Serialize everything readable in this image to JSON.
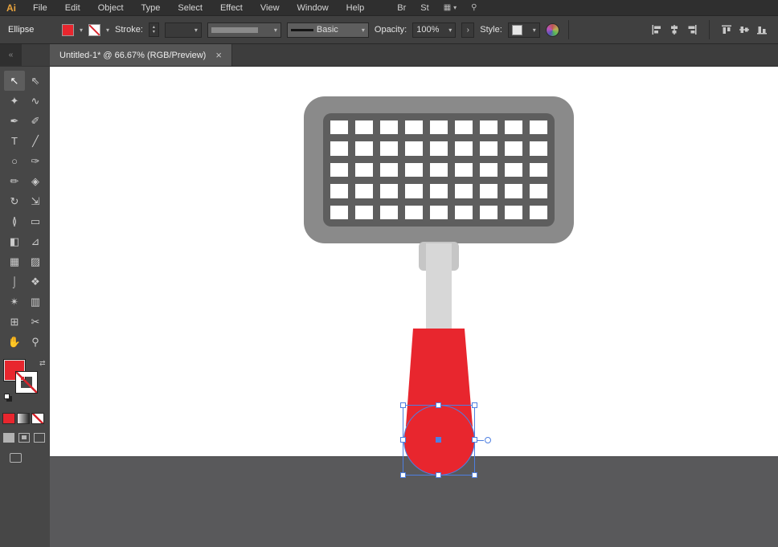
{
  "app": {
    "logo_text": "Ai"
  },
  "menubar": {
    "items": [
      "File",
      "Edit",
      "Object",
      "Type",
      "Select",
      "Effect",
      "View",
      "Window",
      "Help"
    ],
    "bridge_label": "Br",
    "stock_label": "St"
  },
  "icons": {
    "caret_down": "▾",
    "expand_chevron": "›",
    "spinner_up": "▴",
    "spinner_down": "▾",
    "workspace": "▦",
    "search": "⚲",
    "swap": "⇄",
    "collapse": "«",
    "close": "×"
  },
  "controlbar": {
    "context_label": "Ellipse",
    "stroke_label": "Stroke:",
    "brush_name": "Basic",
    "opacity_label": "Opacity:",
    "opacity_value": "100%",
    "style_label": "Style:"
  },
  "tabbar": {
    "tab_title": "Untitled-1* @ 66.67% (RGB/Preview)"
  },
  "toolbar": {
    "tools": [
      {
        "name": "selection-tool",
        "glyph": "↖",
        "active": true
      },
      {
        "name": "direct-selection-tool",
        "glyph": "⇖",
        "active": false
      },
      {
        "name": "magic-wand-tool",
        "glyph": "✦",
        "active": false
      },
      {
        "name": "lasso-tool",
        "glyph": "∿",
        "active": false
      },
      {
        "name": "pen-tool",
        "glyph": "✒",
        "active": false
      },
      {
        "name": "curvature-tool",
        "glyph": "✐",
        "active": false
      },
      {
        "name": "type-tool",
        "glyph": "T",
        "active": false
      },
      {
        "name": "line-segment-tool",
        "glyph": "╱",
        "active": false
      },
      {
        "name": "ellipse-tool",
        "glyph": "○",
        "active": false
      },
      {
        "name": "paintbrush-tool",
        "glyph": "✑",
        "active": false
      },
      {
        "name": "pencil-tool",
        "glyph": "✏",
        "active": false
      },
      {
        "name": "shaper-tool",
        "glyph": "◈",
        "active": false
      },
      {
        "name": "rotate-tool",
        "glyph": "↻",
        "active": false
      },
      {
        "name": "scale-tool",
        "glyph": "⇲",
        "active": false
      },
      {
        "name": "width-tool",
        "glyph": "≬",
        "active": false
      },
      {
        "name": "free-transform-tool",
        "glyph": "▭",
        "active": false
      },
      {
        "name": "shape-builder-tool",
        "glyph": "◧",
        "active": false
      },
      {
        "name": "perspective-grid-tool",
        "glyph": "⊿",
        "active": false
      },
      {
        "name": "mesh-tool",
        "glyph": "▦",
        "active": false
      },
      {
        "name": "gradient-tool",
        "glyph": "▨",
        "active": false
      },
      {
        "name": "eyedropper-tool",
        "glyph": "⌡",
        "active": false
      },
      {
        "name": "blend-tool",
        "glyph": "❖",
        "active": false
      },
      {
        "name": "symbol-sprayer-tool",
        "glyph": "✴",
        "active": false
      },
      {
        "name": "column-graph-tool",
        "glyph": "▥",
        "active": false
      },
      {
        "name": "artboard-tool",
        "glyph": "⊞",
        "active": false
      },
      {
        "name": "slice-tool",
        "glyph": "✂",
        "active": false
      },
      {
        "name": "hand-tool",
        "glyph": "✋",
        "active": false
      },
      {
        "name": "zoom-tool",
        "glyph": "⚲",
        "active": false
      }
    ]
  },
  "artwork": {
    "grid_rows": 5,
    "grid_cols": 9
  },
  "colors": {
    "red": "#e8262e",
    "blue": "#4e7fe1",
    "head": "#8a8a8a",
    "griddark": "#5e5e5e",
    "cell": "#ffffff",
    "shaft": "#d7d7d7",
    "connector": "#c6c6c6",
    "pasteboard": "#59595b"
  }
}
